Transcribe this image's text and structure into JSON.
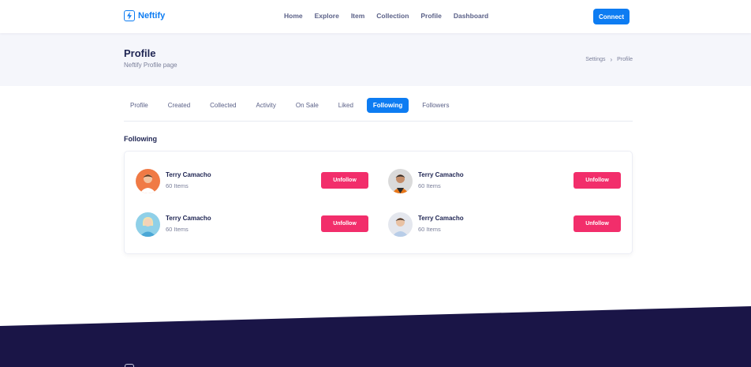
{
  "brand": {
    "name": "Neftify",
    "accent": "#0d7cf2"
  },
  "nav": {
    "items": [
      "Home",
      "Explore",
      "Item",
      "Collection",
      "Profile",
      "Dashboard"
    ]
  },
  "header": {
    "connect_label": "Connect"
  },
  "hero": {
    "title": "Profile",
    "subtitle": "Neftify Profile page",
    "breadcrumb": [
      "Settings",
      "Profile"
    ]
  },
  "tabs": {
    "items": [
      "Profile",
      "Created",
      "Collected",
      "Activity",
      "On Sale",
      "Liked",
      "Following",
      "Followers"
    ],
    "active": "Following"
  },
  "following": {
    "title": "Following",
    "button_color": "#f22e6b",
    "people": [
      {
        "name": "Terry Camacho",
        "items": "60 Items",
        "button": "Unfollow",
        "avatar_color": "#f07a45"
      },
      {
        "name": "Terry Camacho",
        "items": "60 Items",
        "button": "Unfollow",
        "avatar_color": "#e8771a"
      },
      {
        "name": "Terry Camacho",
        "items": "60 Items",
        "button": "Unfollow",
        "avatar_color": "#8fd0e8"
      },
      {
        "name": "Terry Camacho",
        "items": "60 Items",
        "button": "Unfollow",
        "avatar_color": "#b8cde8"
      }
    ]
  },
  "footer": {
    "background": "#1a1547"
  }
}
